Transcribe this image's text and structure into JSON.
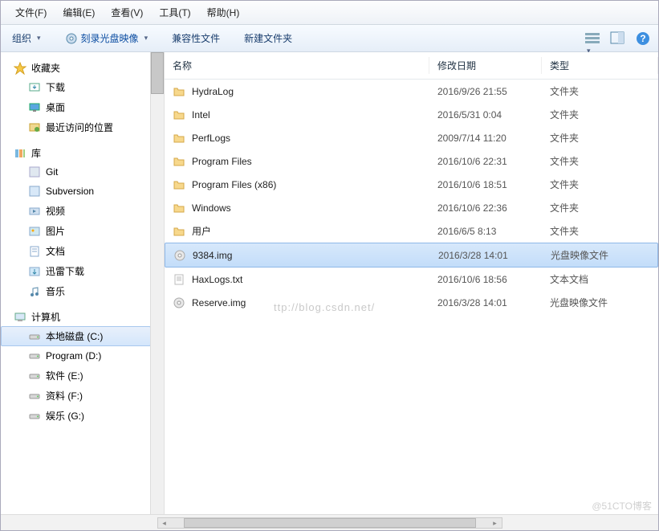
{
  "menu": {
    "file": "文件(F)",
    "edit": "编辑(E)",
    "view": "查看(V)",
    "tools": "工具(T)",
    "help": "帮助(H)"
  },
  "toolbar": {
    "organize": "组织",
    "burn": "刻录光盘映像",
    "compat": "兼容性文件",
    "newfolder": "新建文件夹"
  },
  "nav": {
    "favorites": {
      "label": "收藏夹",
      "items": [
        {
          "icon": "download",
          "label": "下载"
        },
        {
          "icon": "desktop",
          "label": "桌面"
        },
        {
          "icon": "recent",
          "label": "最近访问的位置"
        }
      ]
    },
    "libraries": {
      "label": "库",
      "items": [
        {
          "icon": "git",
          "label": "Git"
        },
        {
          "icon": "svn",
          "label": "Subversion"
        },
        {
          "icon": "video",
          "label": "视频"
        },
        {
          "icon": "pic",
          "label": "图片"
        },
        {
          "icon": "doc",
          "label": "文档"
        },
        {
          "icon": "xunlei",
          "label": "迅雷下载"
        },
        {
          "icon": "music",
          "label": "音乐"
        }
      ]
    },
    "computer": {
      "label": "计算机",
      "items": [
        {
          "icon": "drive",
          "label": "本地磁盘 (C:)",
          "selected": true
        },
        {
          "icon": "drive",
          "label": "Program (D:)"
        },
        {
          "icon": "drive",
          "label": "软件 (E:)"
        },
        {
          "icon": "drive",
          "label": "资料 (F:)"
        },
        {
          "icon": "drive",
          "label": "娱乐 (G:)"
        }
      ]
    }
  },
  "columns": {
    "name": "名称",
    "date": "修改日期",
    "type": "类型"
  },
  "files": [
    {
      "icon": "folder",
      "name": "HydraLog",
      "date": "2016/9/26 21:55",
      "type": "文件夹"
    },
    {
      "icon": "folder",
      "name": "Intel",
      "date": "2016/5/31 0:04",
      "type": "文件夹"
    },
    {
      "icon": "folder",
      "name": "PerfLogs",
      "date": "2009/7/14 11:20",
      "type": "文件夹"
    },
    {
      "icon": "folder",
      "name": "Program Files",
      "date": "2016/10/6 22:31",
      "type": "文件夹"
    },
    {
      "icon": "folder",
      "name": "Program Files (x86)",
      "date": "2016/10/6 18:51",
      "type": "文件夹"
    },
    {
      "icon": "folder",
      "name": "Windows",
      "date": "2016/10/6 22:36",
      "type": "文件夹"
    },
    {
      "icon": "folder",
      "name": "用户",
      "date": "2016/6/5 8:13",
      "type": "文件夹"
    },
    {
      "icon": "img",
      "name": "9384.img",
      "date": "2016/3/28 14:01",
      "type": "光盘映像文件",
      "selected": true
    },
    {
      "icon": "txt",
      "name": "HaxLogs.txt",
      "date": "2016/10/6 18:56",
      "type": "文本文档"
    },
    {
      "icon": "img",
      "name": "Reserve.img",
      "date": "2016/3/28 14:01",
      "type": "光盘映像文件"
    }
  ],
  "watermark": "ttp://blog.csdn.net/",
  "watermark2": "@51CTO博客"
}
